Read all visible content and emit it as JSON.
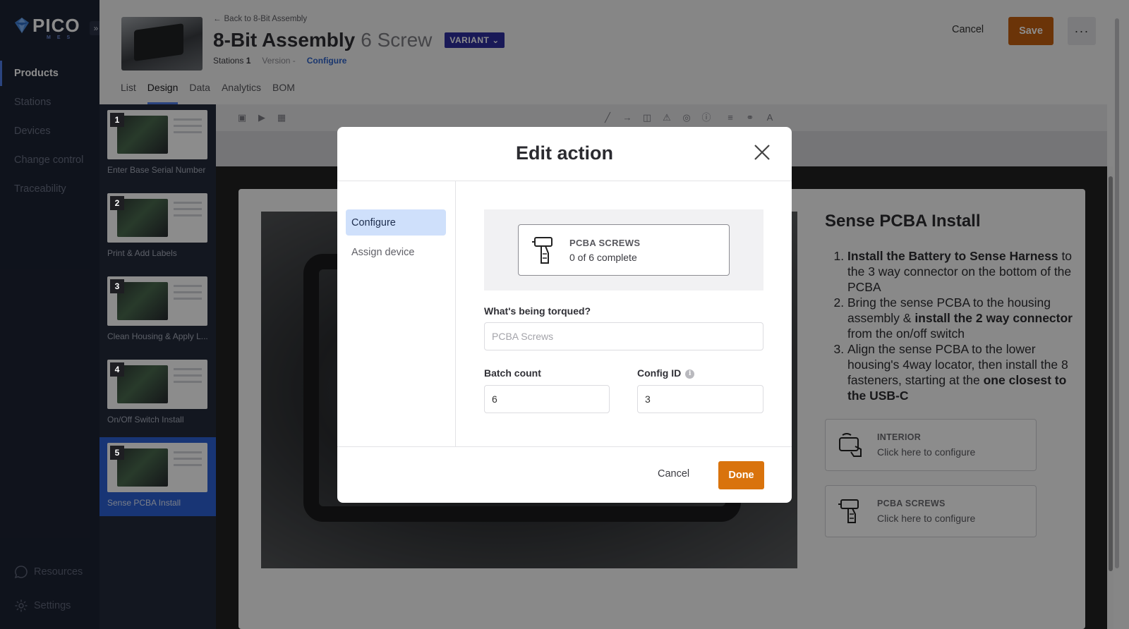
{
  "app": {
    "brand": "PICO",
    "brand_sub": "MES",
    "collapse_icon": "double-chevron-right-icon"
  },
  "nav": {
    "items": [
      {
        "label": "Products",
        "active": true
      },
      {
        "label": "Stations",
        "active": false
      },
      {
        "label": "Devices",
        "active": false
      },
      {
        "label": "Change control",
        "active": false
      },
      {
        "label": "Traceability",
        "active": false
      }
    ],
    "resources_label": "Resources",
    "settings_label": "Settings"
  },
  "header": {
    "back_label": "Back to 8-Bit Assembly",
    "title": "8-Bit Assembly",
    "title_variant": "6 Screw",
    "variant_badge": "VARIANT",
    "stations_label": "Stations",
    "stations_value": "1",
    "version_label": "Version",
    "version_value": "-",
    "configure_link": "Configure",
    "tabs": [
      {
        "label": "List",
        "active": false
      },
      {
        "label": "Design",
        "active": true
      },
      {
        "label": "Data",
        "active": false
      },
      {
        "label": "Analytics",
        "active": false
      },
      {
        "label": "BOM",
        "active": false
      }
    ],
    "cancel_label": "Cancel",
    "save_label": "Save",
    "more_label": "···"
  },
  "steps": [
    {
      "num": "1",
      "label": "Enter Base Serial Number",
      "active": false
    },
    {
      "num": "2",
      "label": "Print & Add Labels",
      "active": false
    },
    {
      "num": "3",
      "label": "Clean Housing & Apply L...",
      "active": false
    },
    {
      "num": "4",
      "label": "On/Off Switch Install",
      "active": false
    },
    {
      "num": "5",
      "label": "Sense PCBA Install",
      "active": true
    }
  ],
  "slide": {
    "title": "Sense PCBA Install",
    "instructions": [
      {
        "bold": "Install the Battery to Sense Harness",
        "rest": " to the 3 way connector on the bottom of the PCBA"
      },
      {
        "pre": "Bring the sense PCBA to the housing assembly & ",
        "bold": "install the 2 way connector",
        "rest": " from the on/off switch"
      },
      {
        "pre": "Align the sense PCBA to the lower housing's 4way locator, then install the 8 fasteners, starting at the ",
        "bold": "one closest to the USB-C",
        "rest": ""
      }
    ],
    "actions": [
      {
        "title": "INTERIOR",
        "subtitle": "Click here to configure",
        "icon": "camera-hand-icon"
      },
      {
        "title": "PCBA SCREWS",
        "subtitle": "Click here to configure",
        "icon": "screwdriver-drill-icon"
      }
    ]
  },
  "modal": {
    "title": "Edit action",
    "tabs": [
      {
        "label": "Configure",
        "active": true
      },
      {
        "label": "Assign device",
        "active": false
      }
    ],
    "preview": {
      "title": "PCBA SCREWS",
      "subtitle": "0 of 6 complete",
      "icon": "screwdriver-drill-icon"
    },
    "torqued_label": "What's being torqued?",
    "torqued_placeholder": "PCBA Screws",
    "torqued_value": "",
    "batch_label": "Batch count",
    "batch_value": "6",
    "config_label": "Config ID",
    "config_value": "3",
    "cancel_label": "Cancel",
    "done_label": "Done"
  },
  "colors": {
    "nav_bg": "#1d2333",
    "accent_blue": "#4f7de8",
    "save_orange": "#c45f0f",
    "done_orange": "#d9730d",
    "variant_purple": "#2e2e9e"
  }
}
